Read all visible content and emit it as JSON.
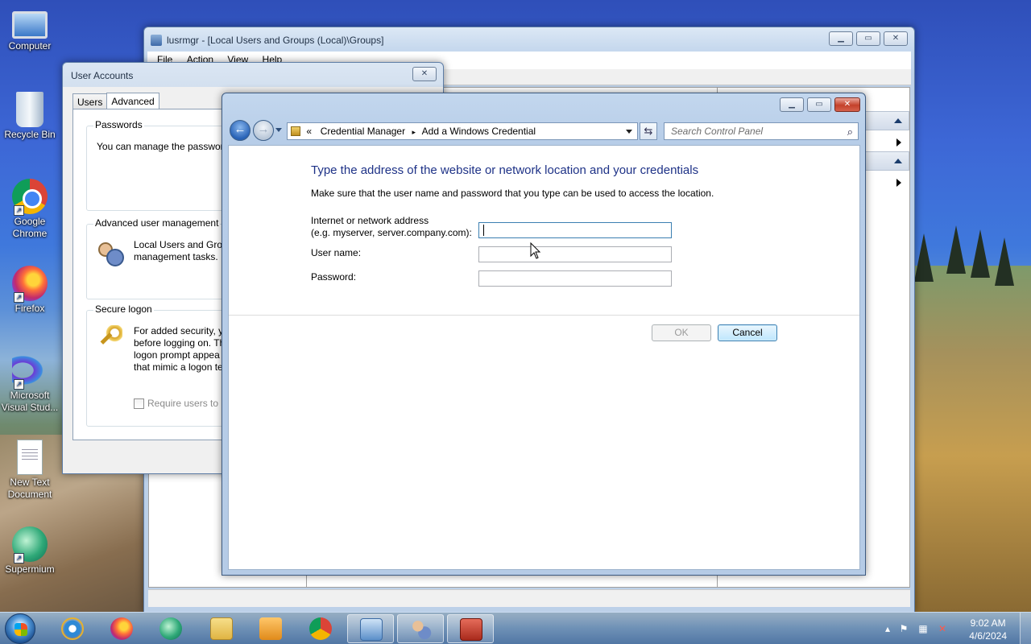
{
  "desktop": {
    "icons": [
      {
        "label": "Computer",
        "icon": "computer-icon"
      },
      {
        "label": "Recycle Bin",
        "icon": "recycle-bin-icon"
      },
      {
        "label": "Google Chrome",
        "icon": "chrome-icon"
      },
      {
        "label": "Firefox",
        "icon": "firefox-icon"
      },
      {
        "label": "Microsoft Visual Stud...",
        "icon": "visual-studio-icon"
      },
      {
        "label": "New Text Document",
        "icon": "text-document-icon"
      },
      {
        "label": "Supermium",
        "icon": "supermium-icon"
      }
    ]
  },
  "lusrmgr": {
    "title": "lusrmgr - [Local Users and Groups (Local)\\Groups]",
    "menu": [
      "File",
      "Action",
      "View",
      "Help"
    ]
  },
  "user_accounts": {
    "title": "User Accounts",
    "tabs": [
      "Users",
      "Advanced"
    ],
    "active_tab": "Advanced",
    "passwords": {
      "label": "Passwords",
      "text": "You can manage the passwor"
    },
    "advanced_user_mgmt": {
      "label": "Advanced user management",
      "text_line1": "Local Users and Grou",
      "text_line2": "management tasks."
    },
    "secure_logon": {
      "label": "Secure logon",
      "line1": "For added security, y",
      "line2": "before logging on. Th",
      "line3": "logon prompt appea",
      "line4": "that mimic a logon te",
      "checkbox_label": "Require users to p"
    }
  },
  "credential_dialog": {
    "breadcrumb": {
      "prefix": "«",
      "item1": "Credential Manager",
      "separator": "▸",
      "item2": "Add a Windows Credential"
    },
    "search_placeholder": "Search Control Panel",
    "heading": "Type the address of the website or network location and your credentials",
    "description": "Make sure that the user name and password that you type can be used to access the location.",
    "fields": {
      "address_label_line1": "Internet or network address",
      "address_label_line2": "(e.g. myserver, server.company.com):",
      "address_value": "",
      "username_label": "User name:",
      "username_value": "",
      "password_label": "Password:",
      "password_value": ""
    },
    "buttons": {
      "ok": "OK",
      "cancel": "Cancel"
    },
    "ok_enabled": false
  },
  "taskbar": {
    "pinned": [
      "internet-explorer-icon",
      "firefox-icon",
      "supermium-icon",
      "file-explorer-icon",
      "media-player-icon",
      "chrome-icon",
      "control-panel-icon",
      "user-accounts-icon",
      "toolbox-icon"
    ],
    "clock_time": "9:02 AM",
    "clock_date": "4/6/2024"
  },
  "colors": {
    "heading_blue": "#1e3287",
    "accent": "#3c7fb1"
  }
}
